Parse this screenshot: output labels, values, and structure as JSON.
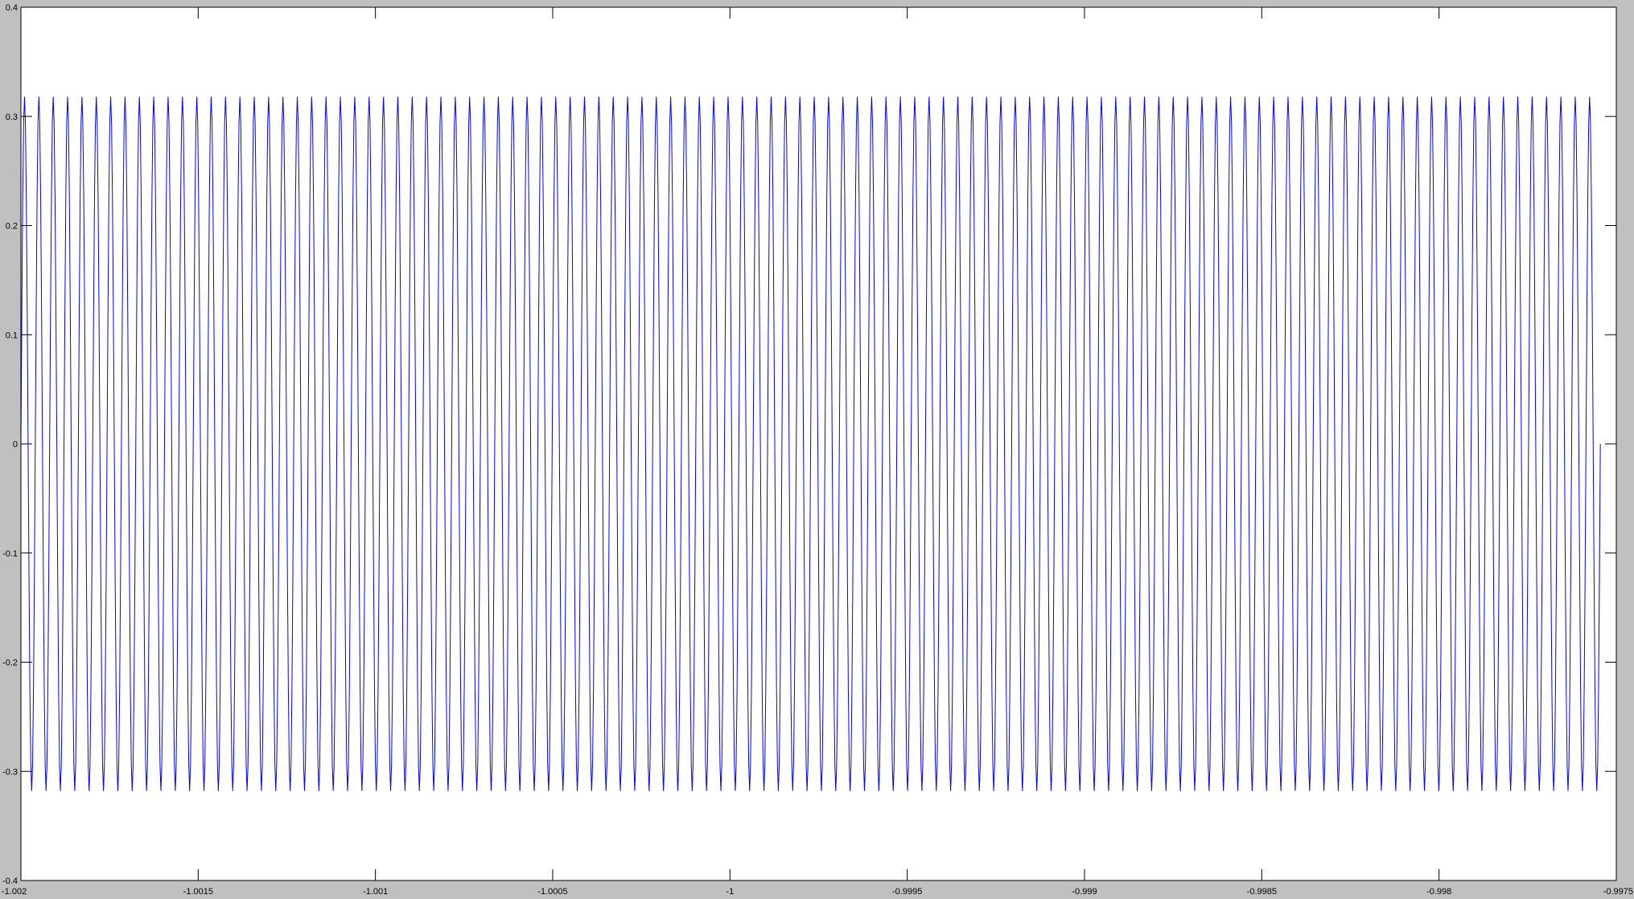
{
  "colors": {
    "figure_background": "#c0c0c0",
    "axes_background": "#ffffff",
    "axes_edge": "#000000",
    "series_line": "#0000ff"
  },
  "chart_data": {
    "type": "line",
    "title": "",
    "xlabel": "",
    "ylabel": "",
    "xlim": [
      -1.002,
      -0.9975
    ],
    "ylim": [
      -0.4,
      0.4
    ],
    "grid": false,
    "legend": "none",
    "x_ticks": [
      -1.002,
      -1.0015,
      -1.001,
      -1.0005,
      -1,
      -0.9995,
      -0.999,
      -0.9985,
      -0.998,
      -0.9975
    ],
    "x_tick_labels": [
      "-1.002",
      "-1.0015",
      "-1.001",
      "-1.0005",
      "-1",
      "-0.9995",
      "-0.999",
      "-0.9985",
      "-0.998",
      "-0.9975"
    ],
    "y_ticks": [
      -0.4,
      -0.3,
      -0.2,
      -0.1,
      0,
      0.1,
      0.2,
      0.3,
      0.4
    ],
    "y_tick_labels": [
      "-0.4",
      "-0.3",
      "-0.2",
      "-0.1",
      "0",
      "0.1",
      "0.2",
      "0.3",
      "0.4"
    ],
    "series": [
      {
        "description_in_data_units": "sinusoid, ~110 cycles over the visible x range",
        "amplitude": 0.318,
        "offset": 0,
        "period": 4.05e-05,
        "x_start": -1.002,
        "x_end": -0.99755,
        "cycles": 110
      }
    ]
  }
}
